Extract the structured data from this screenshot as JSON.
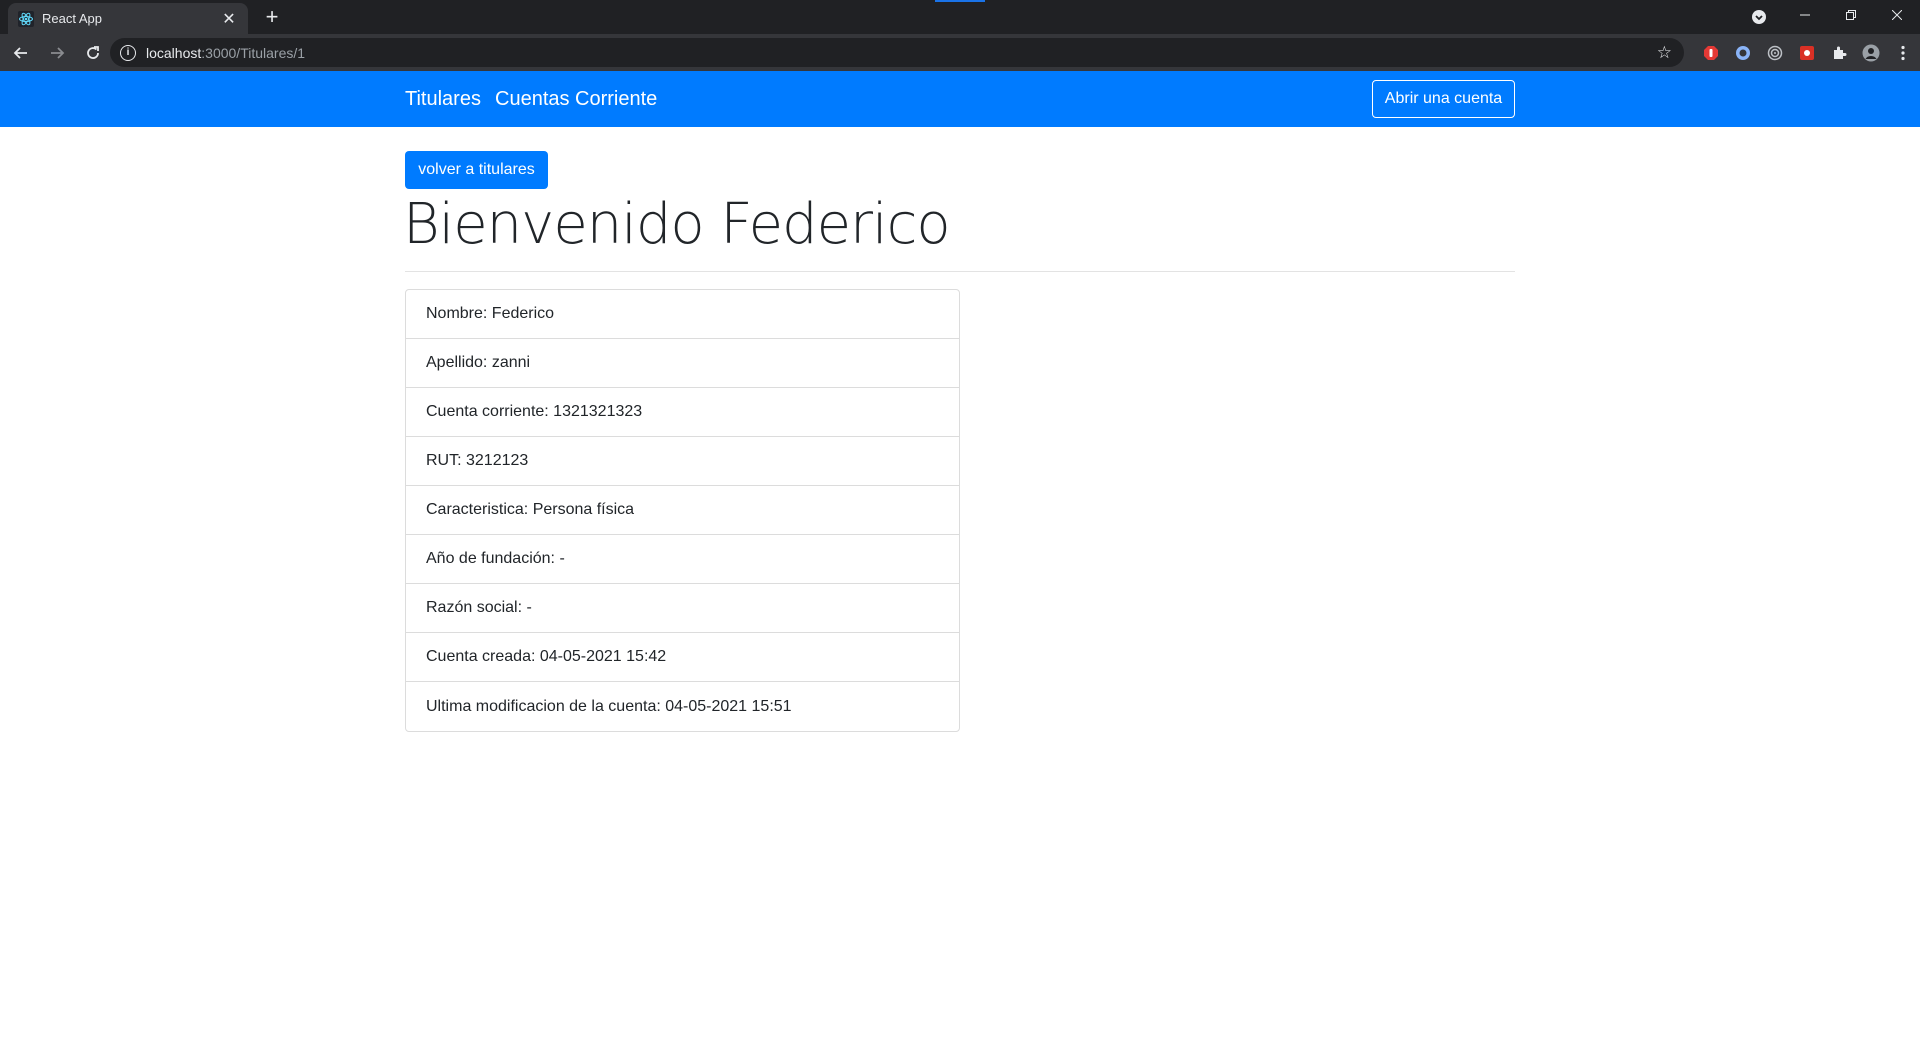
{
  "browser": {
    "tab_title": "React App",
    "url_host": "localhost",
    "url_path": ":3000/Titulares/1",
    "new_tab_glyph": "+",
    "close_glyph": "✕"
  },
  "navbar": {
    "links": [
      "Titulares",
      "Cuentas Corriente"
    ],
    "open_account_label": "Abrir una cuenta",
    "color": "#007bff"
  },
  "main": {
    "back_button_label": "volver a titulares",
    "heading": "Bienvenido Federico",
    "details": [
      "Nombre: Federico",
      "Apellido: zanni",
      "Cuenta corriente: 1321321323",
      "RUT: 3212123",
      "Caracteristica: Persona física",
      "Año de fundación: -",
      "Razón social: -",
      "Cuenta creada: 04-05-2021 15:42",
      "Ultima modificacion de la cuenta: 04-05-2021 15:51"
    ]
  }
}
